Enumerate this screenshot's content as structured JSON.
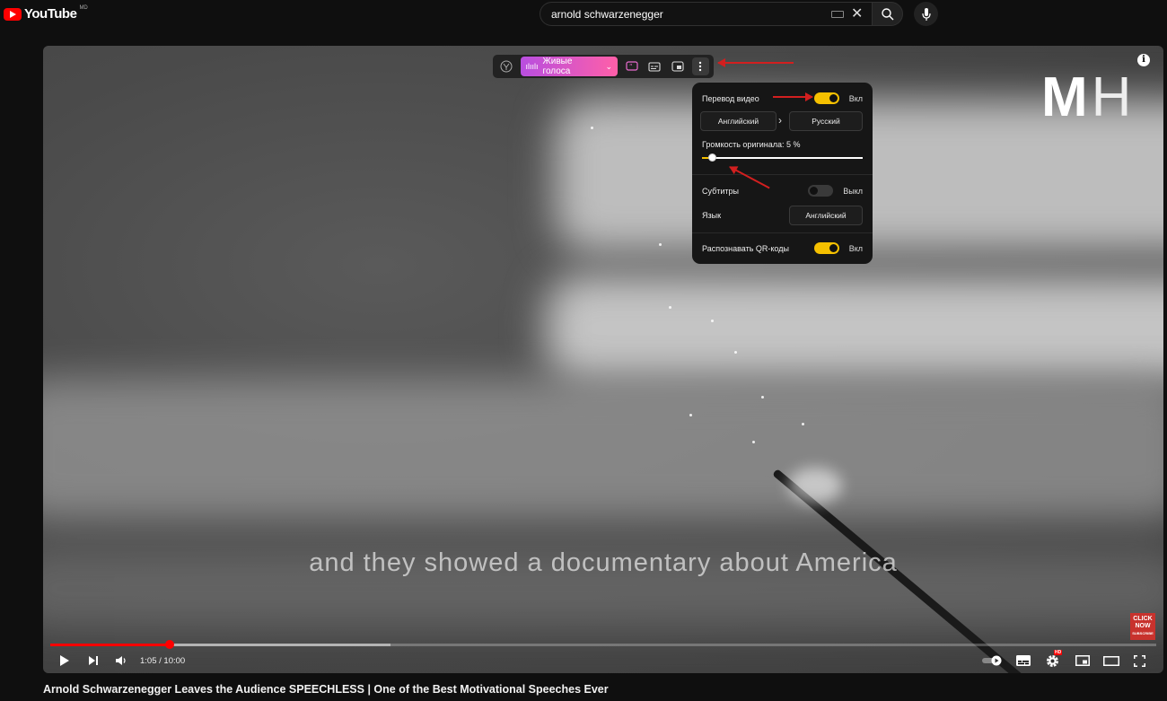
{
  "header": {
    "logo_text": "YouTube",
    "logo_region": "MD",
    "search_value": "arnold schwarzenegger"
  },
  "translator": {
    "live_voices_label": "Живые голоса",
    "panel": {
      "video_translation_label": "Перевод видео",
      "video_translation_state": "Вкл",
      "source_lang": "Английский",
      "target_lang": "Русский",
      "original_volume_label": "Громкость оригинала: 5 %",
      "original_volume_percent": 5,
      "subtitles_label": "Субтитры",
      "subtitles_state": "Выкл",
      "language_label": "Язык",
      "subtitle_lang": "Английский",
      "qr_label": "Распознавать QR-коды",
      "qr_state": "Вкл"
    }
  },
  "video": {
    "watermark_bold": "M",
    "watermark_light": "H",
    "subtitle": "and they showed a documentary about America",
    "click_now": "CLICK NOW",
    "click_now_small": "SUBSCRIBE",
    "time_display": "1:05 / 10:00",
    "played_fraction": 0.108,
    "buffered_fraction": 0.308,
    "settings_badge": "HD"
  },
  "title": "Arnold Schwarzenegger Leaves the Audience SPEECHLESS | One of the Best Motivational Speeches Ever",
  "colors": {
    "youtube_red": "#ff0000",
    "toggle_on": "#f5c000",
    "live_voices_gradient_start": "#b84ee0",
    "live_voices_gradient_end": "#ff5fa8",
    "annotation_arrow": "#d21f1f"
  },
  "icons": [
    "youtube-logo-icon",
    "keyboard-icon",
    "clear-icon",
    "search-icon",
    "mic-icon",
    "yandex-icon",
    "chevron-down-icon",
    "quote-icon",
    "subtitles-icon",
    "pip-icon",
    "more-icon",
    "info-icon",
    "play-icon",
    "next-icon",
    "volume-icon",
    "autoplay-icon",
    "captions-icon",
    "settings-icon",
    "miniplayer-icon",
    "theater-icon",
    "fullscreen-icon"
  ]
}
